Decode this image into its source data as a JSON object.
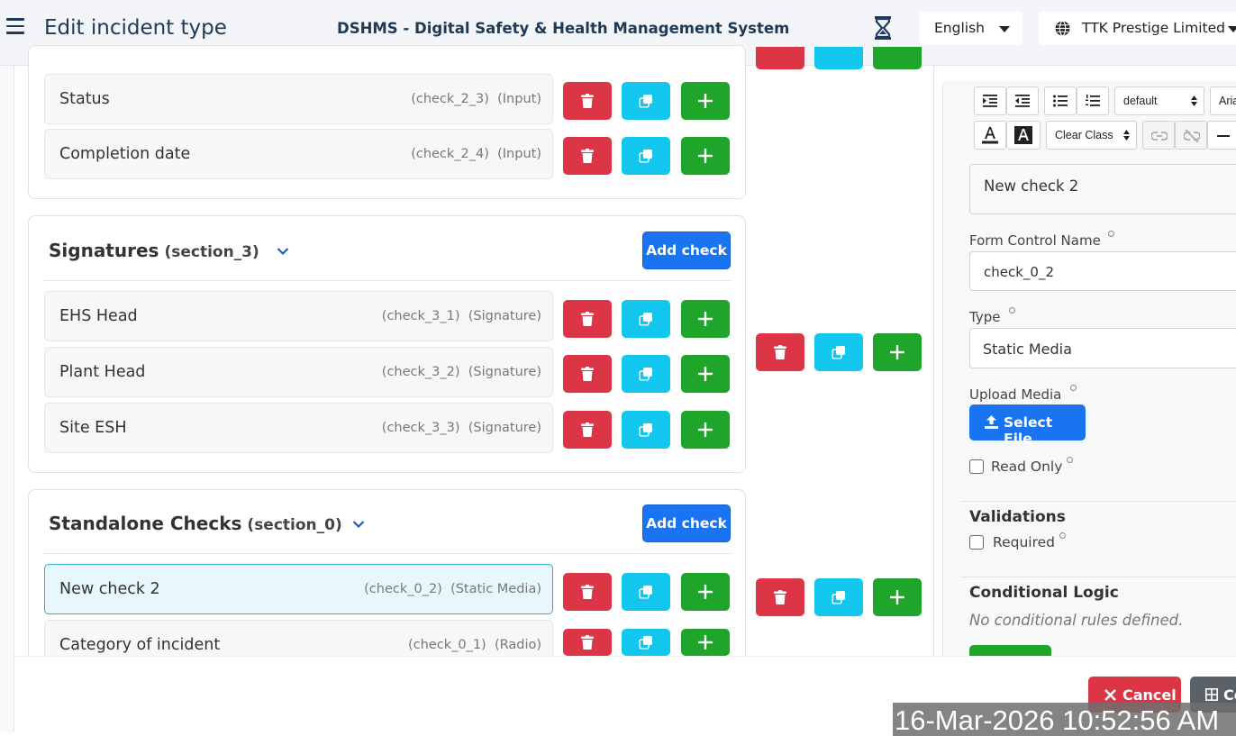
{
  "header": {
    "page_title": "Edit incident type",
    "app_title": "DSHMS - Digital Safety & Health Management System",
    "language": "English",
    "company": "TTK Prestige Limited"
  },
  "sections": [
    {
      "checks": [
        {
          "name": "Status",
          "id": "(check_2_3)",
          "type": "(Input)"
        },
        {
          "name": "Completion date",
          "id": "(check_2_4)",
          "type": "(Input)"
        }
      ]
    },
    {
      "title": "Signatures",
      "id": "(section_3)",
      "add_label": "Add check",
      "checks": [
        {
          "name": "EHS Head",
          "id": "(check_3_1)",
          "type": "(Signature)"
        },
        {
          "name": "Plant Head",
          "id": "(check_3_2)",
          "type": "(Signature)"
        },
        {
          "name": "Site ESH",
          "id": "(check_3_3)",
          "type": "(Signature)"
        }
      ]
    },
    {
      "title": "Standalone Checks",
      "id": "(section_0)",
      "add_label": "Add check",
      "checks": [
        {
          "name": "New check 2",
          "id": "(check_0_2)",
          "type": "(Static Media)"
        },
        {
          "name": "Category of incident",
          "id": "(check_0_1)",
          "type": "(Radio)"
        }
      ]
    }
  ],
  "editor": {
    "toolbar": {
      "font_size": "default",
      "font_name": "Aria",
      "clear_class": "Clear Class"
    },
    "label_value": "New check 2",
    "form_control_name_label": "Form Control Name",
    "form_control_name_value": "check_0_2",
    "type_label": "Type",
    "type_value": "Static Media",
    "upload_media_label": "Upload Media",
    "select_file_label": "Select File",
    "read_only_label": "Read Only",
    "validations_title": "Validations",
    "required_label": "Required",
    "conditional_logic_title": "Conditional Logic",
    "no_rules_text": "No conditional rules defined."
  },
  "footer": {
    "cancel_label": "Cancel",
    "confirm_label": "Co"
  },
  "timestamp": "16-Mar-2026 10:52:56 AM",
  "colors": {
    "delete": "#dc3545",
    "copy": "#13c6ee",
    "add": "#1fa52b",
    "primary": "#1a73f0"
  }
}
